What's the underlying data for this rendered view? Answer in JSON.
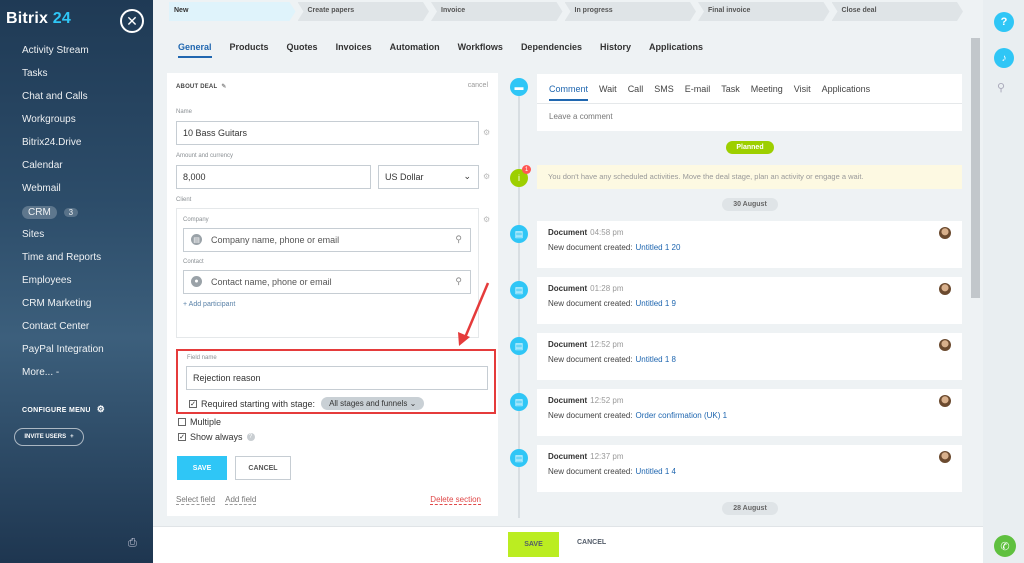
{
  "sidebar": {
    "logo_main": "Bitrix",
    "logo_num": "24",
    "close_glyph": "✕",
    "items": [
      {
        "label": "Activity Stream"
      },
      {
        "label": "Tasks"
      },
      {
        "label": "Chat and Calls"
      },
      {
        "label": "Workgroups"
      },
      {
        "label": "Bitrix24.Drive"
      },
      {
        "label": "Calendar"
      },
      {
        "label": "Webmail"
      },
      {
        "label": "CRM",
        "count": "3"
      },
      {
        "label": "Sites"
      },
      {
        "label": "Time and Reports"
      },
      {
        "label": "Employees"
      },
      {
        "label": "CRM Marketing"
      },
      {
        "label": "Contact Center"
      },
      {
        "label": "PayPal Integration"
      },
      {
        "label": "More... -"
      }
    ],
    "configure_menu": "CONFIGURE MENU",
    "invite_users": "INVITE USERS",
    "invite_plus": "+"
  },
  "stages": [
    "New",
    "Create papers",
    "Invoice",
    "In progress",
    "Final invoice",
    "Close deal"
  ],
  "tabs": [
    "General",
    "Products",
    "Quotes",
    "Invoices",
    "Automation",
    "Workflows",
    "Dependencies",
    "History",
    "Applications"
  ],
  "about": {
    "title": "ABOUT DEAL",
    "cancel": "cancel",
    "name_label": "Name",
    "name_value": "10 Bass Guitars",
    "amount_label": "Amount and currency",
    "amount_value": "8,000",
    "currency_value": "US Dollar",
    "client_label": "Client",
    "company_label": "Company",
    "company_placeholder": "Company name, phone or email",
    "contact_label": "Contact",
    "contact_placeholder": "Contact name, phone or email",
    "add_participant": "+ Add participant",
    "field_name_label": "Field name",
    "field_name_value": "Rejection reason",
    "required_label": "Required starting with stage:",
    "stage_select": "All stages and funnels",
    "multiple_label": "Multiple",
    "show_always_label": "Show always",
    "save": "SAVE",
    "cancel_btn": "CANCEL",
    "select_field": "Select field",
    "add_field": "Add field",
    "delete_section": "Delete section"
  },
  "comment": {
    "tabs": [
      "Comment",
      "Wait",
      "Call",
      "SMS",
      "E-mail",
      "Task",
      "Meeting",
      "Visit",
      "Applications"
    ],
    "placeholder": "Leave a comment"
  },
  "timeline": {
    "planned": "Planned",
    "notice": "You don't have any scheduled activities. Move the deal stage, plan an activity or engage a wait.",
    "notice_badge": "1",
    "date1": "30 August",
    "date2": "28 August",
    "docs": [
      {
        "title": "Document",
        "time": "04:58 pm",
        "text": "New document created:",
        "link": "Untitled 1 20"
      },
      {
        "title": "Document",
        "time": "01:28 pm",
        "text": "New document created:",
        "link": "Untitled 1 9"
      },
      {
        "title": "Document",
        "time": "12:52 pm",
        "text": "New document created:",
        "link": "Untitled 1 8"
      },
      {
        "title": "Document",
        "time": "12:52 pm",
        "text": "New document created:",
        "link": "Order confirmation (UK) 1"
      },
      {
        "title": "Document",
        "time": "12:37 pm",
        "text": "New document created:",
        "link": "Untitled 1 4"
      }
    ]
  },
  "bottom": {
    "save": "SAVE",
    "cancel": "CANCEL"
  },
  "colors": {
    "accent": "#2fc6f6",
    "link": "#2067b0",
    "green": "#9dcf00",
    "highlight_red": "#e53b3b",
    "save_green": "#bbed21"
  }
}
